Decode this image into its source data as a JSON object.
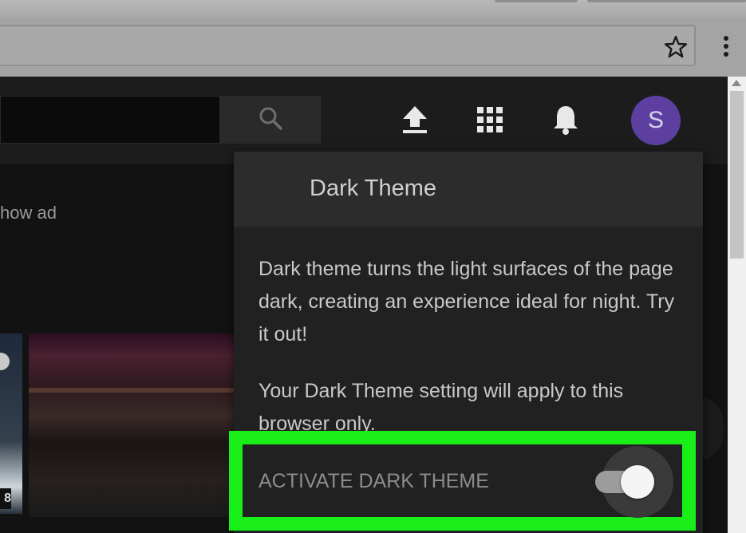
{
  "browser": {
    "star_icon": "star-outline-icon",
    "menu_icon": "vertical-dots-icon"
  },
  "header": {
    "search_icon": "search-icon",
    "upload_icon": "upload-icon",
    "apps_icon": "grid-apps-icon",
    "notifications_icon": "bell-icon",
    "avatar_letter": "S",
    "avatar_color": "#5c3fa0"
  },
  "content": {
    "ad_text": "how ad",
    "duration_fragment": "8"
  },
  "dark_theme_panel": {
    "title": "Dark Theme",
    "description": "Dark theme turns the light surfaces of the page dark, creating an experience ideal for night. Try it out!",
    "note": "Your Dark Theme setting will apply to this browser only.",
    "toggle_label": "ACTIVATE DARK THEME",
    "toggle_state": "on",
    "highlight_color": "#19ee19"
  }
}
